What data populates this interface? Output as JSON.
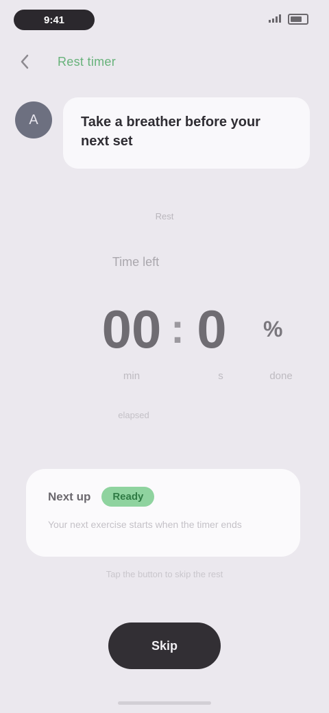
{
  "status_bar": {
    "time": "9:41",
    "signal_icon": "signal-icon",
    "battery_icon": "battery-icon"
  },
  "header": {
    "back_icon": "chevron-left-icon",
    "title": "Rest timer"
  },
  "message": {
    "avatar_icon": "assistant-avatar-icon",
    "avatar_initial": "A",
    "text": "Take a breather before your next set"
  },
  "timer": {
    "hint": "Rest",
    "label": "Time left",
    "minutes": "00",
    "separator": ":",
    "seconds": "0",
    "unit": "%",
    "caption_minutes": "min",
    "caption_seconds": "s",
    "caption_unit": "done",
    "subcaption": "elapsed"
  },
  "info_card": {
    "label": "Next up",
    "badge": "Ready",
    "text": "Your next exercise starts when the timer ends"
  },
  "footnote": "Tap the button to skip the rest",
  "primary_button": {
    "label": "Skip"
  },
  "colors": {
    "accent_green": "#67b27a",
    "badge_green": "#8fd39f",
    "button_dark": "#322f34",
    "background": "#ebe8ee"
  }
}
